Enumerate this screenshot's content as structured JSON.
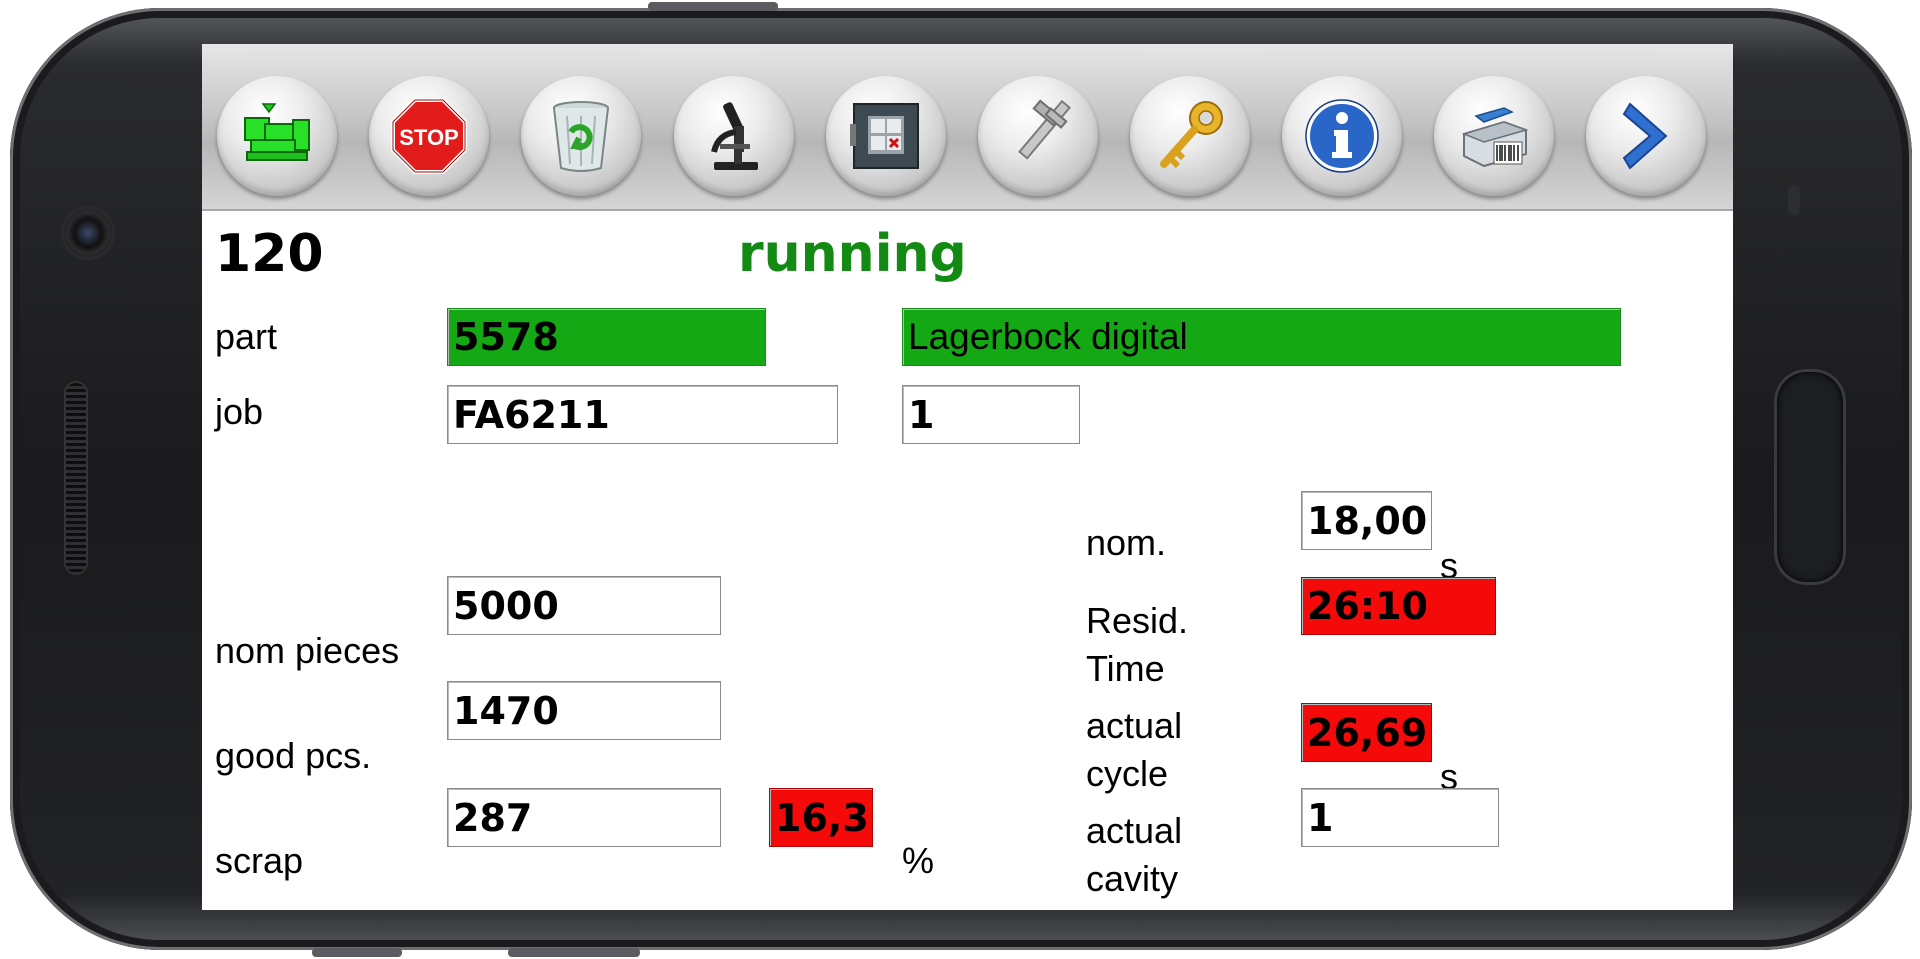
{
  "toolbar": {
    "buttons": [
      {
        "name": "machine-green-button",
        "icon": "machine-icon"
      },
      {
        "name": "stop-button",
        "icon": "stop-sign-icon",
        "label": "STOP"
      },
      {
        "name": "trash-button",
        "icon": "trash-bin-icon"
      },
      {
        "name": "microscope-button",
        "icon": "microscope-icon"
      },
      {
        "name": "grid-button",
        "icon": "grid-panel-icon"
      },
      {
        "name": "caliper-button",
        "icon": "caliper-icon"
      },
      {
        "name": "key-button",
        "icon": "key-icon"
      },
      {
        "name": "info-button",
        "icon": "info-icon"
      },
      {
        "name": "printer-button",
        "icon": "barcode-printer-icon"
      },
      {
        "name": "next-button",
        "icon": "chevron-right-icon"
      }
    ]
  },
  "header": {
    "machine_number": "120",
    "status": "running",
    "status_color": "#138a13"
  },
  "labels": {
    "part": "part",
    "job": "job",
    "nom_pieces": "nom pieces",
    "good_pcs": "good pcs.",
    "scrap": "scrap",
    "nom": "nom.",
    "resid_1": "Resid.",
    "resid_2": "Time",
    "actual_cycle_1": "actual",
    "actual_cycle_2": "cycle",
    "actual_cavity_1": "actual",
    "actual_cavity_2": "cavity",
    "unit_s": "s",
    "unit_pct": "%"
  },
  "values": {
    "part_number": "5578",
    "part_description": "Lagerbock digital",
    "job_number": "FA6211",
    "job_index": "1",
    "nom_pieces": "5000",
    "good_pcs": "1470",
    "scrap": "287",
    "scrap_pct": "16,3",
    "nom_cycle": "18,00",
    "resid_time": "26:10",
    "actual_cycle": "26,69",
    "actual_cavity": "1"
  },
  "colors": {
    "ok": "#14a914",
    "alarm": "#f50a0a"
  }
}
